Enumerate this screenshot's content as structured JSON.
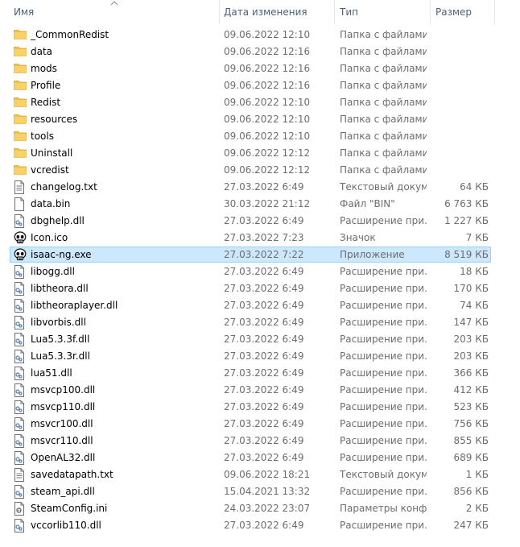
{
  "columns": {
    "name": "Имя",
    "date": "Дата изменения",
    "type": "Тип",
    "size": "Размер"
  },
  "colors": {
    "selection_bg": "#cce8ff",
    "selection_border": "#99d1ff",
    "folder": "#f1c049",
    "header_text": "#4c607a"
  },
  "files": [
    {
      "name": "_CommonRedist",
      "date": "09.06.2022 12:10",
      "type": "Папка с файлами",
      "size": "",
      "icon": "folder-icon"
    },
    {
      "name": "data",
      "date": "09.06.2022 12:16",
      "type": "Папка с файлами",
      "size": "",
      "icon": "folder-icon"
    },
    {
      "name": "mods",
      "date": "09.06.2022 12:16",
      "type": "Папка с файлами",
      "size": "",
      "icon": "folder-icon"
    },
    {
      "name": "Profile",
      "date": "09.06.2022 12:16",
      "type": "Папка с файлами",
      "size": "",
      "icon": "folder-icon"
    },
    {
      "name": "Redist",
      "date": "09.06.2022 12:10",
      "type": "Папка с файлами",
      "size": "",
      "icon": "folder-icon"
    },
    {
      "name": "resources",
      "date": "09.06.2022 12:10",
      "type": "Папка с файлами",
      "size": "",
      "icon": "folder-icon"
    },
    {
      "name": "tools",
      "date": "09.06.2022 12:10",
      "type": "Папка с файлами",
      "size": "",
      "icon": "folder-icon"
    },
    {
      "name": "Uninstall",
      "date": "09.06.2022 12:12",
      "type": "Папка с файлами",
      "size": "",
      "icon": "folder-icon"
    },
    {
      "name": "vcredist",
      "date": "09.06.2022 12:12",
      "type": "Папка с файлами",
      "size": "",
      "icon": "folder-icon"
    },
    {
      "name": "changelog.txt",
      "date": "27.03.2022 6:49",
      "type": "Текстовый докум...",
      "size": "64 КБ",
      "icon": "text-file-icon"
    },
    {
      "name": "data.bin",
      "date": "30.03.2022 21:12",
      "type": "Файл \"BIN\"",
      "size": "6 763 КБ",
      "icon": "file-icon"
    },
    {
      "name": "dbghelp.dll",
      "date": "27.03.2022 6:49",
      "type": "Расширение при...",
      "size": "1 227 КБ",
      "icon": "dll-file-icon"
    },
    {
      "name": "Icon.ico",
      "date": "27.03.2022 7:23",
      "type": "Значок",
      "size": "7 КБ",
      "icon": "skull-icon"
    },
    {
      "name": "isaac-ng.exe",
      "date": "27.03.2022 7:22",
      "type": "Приложение",
      "size": "8 519 КБ",
      "icon": "skull-icon",
      "selected": true
    },
    {
      "name": "libogg.dll",
      "date": "27.03.2022 6:49",
      "type": "Расширение при...",
      "size": "18 КБ",
      "icon": "dll-file-icon"
    },
    {
      "name": "libtheora.dll",
      "date": "27.03.2022 6:49",
      "type": "Расширение при...",
      "size": "170 КБ",
      "icon": "dll-file-icon"
    },
    {
      "name": "libtheoraplayer.dll",
      "date": "27.03.2022 6:49",
      "type": "Расширение при...",
      "size": "74 КБ",
      "icon": "dll-file-icon"
    },
    {
      "name": "libvorbis.dll",
      "date": "27.03.2022 6:49",
      "type": "Расширение при...",
      "size": "147 КБ",
      "icon": "dll-file-icon"
    },
    {
      "name": "Lua5.3.3f.dll",
      "date": "27.03.2022 6:49",
      "type": "Расширение при...",
      "size": "203 КБ",
      "icon": "dll-file-icon"
    },
    {
      "name": "Lua5.3.3r.dll",
      "date": "27.03.2022 6:49",
      "type": "Расширение при...",
      "size": "203 КБ",
      "icon": "dll-file-icon"
    },
    {
      "name": "lua51.dll",
      "date": "27.03.2022 6:49",
      "type": "Расширение при...",
      "size": "366 КБ",
      "icon": "dll-file-icon"
    },
    {
      "name": "msvcp100.dll",
      "date": "27.03.2022 6:49",
      "type": "Расширение при...",
      "size": "412 КБ",
      "icon": "dll-file-icon"
    },
    {
      "name": "msvcp110.dll",
      "date": "27.03.2022 6:49",
      "type": "Расширение при...",
      "size": "523 КБ",
      "icon": "dll-file-icon"
    },
    {
      "name": "msvcr100.dll",
      "date": "27.03.2022 6:49",
      "type": "Расширение при...",
      "size": "756 КБ",
      "icon": "dll-file-icon"
    },
    {
      "name": "msvcr110.dll",
      "date": "27.03.2022 6:49",
      "type": "Расширение при...",
      "size": "855 КБ",
      "icon": "dll-file-icon"
    },
    {
      "name": "OpenAL32.dll",
      "date": "27.03.2022 6:49",
      "type": "Расширение при...",
      "size": "689 КБ",
      "icon": "dll-file-icon"
    },
    {
      "name": "savedatapath.txt",
      "date": "09.06.2022 18:21",
      "type": "Текстовый докум...",
      "size": "1 КБ",
      "icon": "text-file-icon"
    },
    {
      "name": "steam_api.dll",
      "date": "15.04.2021 13:32",
      "type": "Расширение при...",
      "size": "856 КБ",
      "icon": "dll-file-icon"
    },
    {
      "name": "SteamConfig.ini",
      "date": "24.03.2022 23:07",
      "type": "Параметры конф...",
      "size": "2 КБ",
      "icon": "ini-file-icon"
    },
    {
      "name": "vccorlib110.dll",
      "date": "27.03.2022 6:49",
      "type": "Расширение при...",
      "size": "247 КБ",
      "icon": "dll-file-icon"
    }
  ]
}
